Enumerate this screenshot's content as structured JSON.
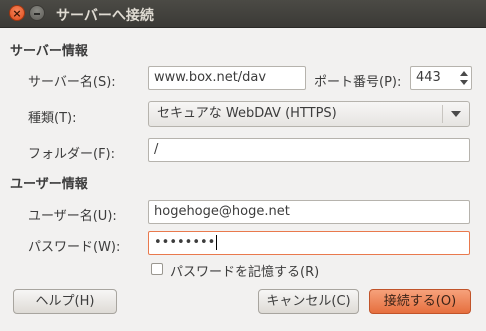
{
  "window": {
    "title": "サーバーへ接続"
  },
  "server_section": {
    "heading": "サーバー情報",
    "server_label": "サーバー名(S):",
    "server_value": "www.box.net/dav",
    "port_label": "ポート番号(P):",
    "port_value": "443",
    "type_label": "種類(T):",
    "type_value": "セキュアな WebDAV (HTTPS)",
    "folder_label": "フォルダー(F):",
    "folder_value": "/"
  },
  "user_section": {
    "heading": "ユーザー情報",
    "username_label": "ユーザー名(U):",
    "username_value": "hogehoge@hoge.net",
    "password_label": "パスワード(W):",
    "password_value": "••••••••",
    "remember_label": "パスワードを記憶する(R)",
    "remember_checked": false
  },
  "buttons": {
    "help": "ヘルプ(H)",
    "cancel": "キャンセル(C)",
    "connect": "接続する(O)"
  },
  "colors": {
    "titlebar": "#3b3a36",
    "accent": "#e66f3e",
    "window_bg": "#f2f1f0"
  }
}
